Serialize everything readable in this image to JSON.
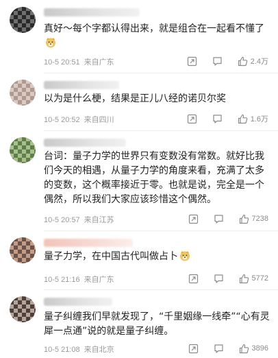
{
  "comments": [
    {
      "text": "真好～每个字都认得出来，就是组合在一起看不懂了",
      "time": "10-5 20:51",
      "location": "来自广东",
      "likes": "2.4万",
      "emoji": "doge-emoji"
    },
    {
      "text": "以为是什么梗，结果是正儿八经的诺贝尔奖",
      "time": "10-5 20:52",
      "location": "来自四川",
      "likes": "1.6万"
    },
    {
      "text": "台词：量子力学的世界只有变数没有常数。就好比我们今天的相遇，从量子力学的角度来看，充满了太多的变数，这个概率接近于零。也就是说，完全是一个偶然，所以我们大家应该珍惜这个偶然。",
      "time": "10-5 20:57",
      "location": "来自江苏",
      "likes": "7238"
    },
    {
      "text": "量子力学，在中国古代叫做占卜",
      "time": "10-5 21:16",
      "location": "来自广东",
      "likes": "5772",
      "emoji": "doge-emoji"
    },
    {
      "text": "量子纠缠我们早就发现了，“千里姻缘一线牵”“心有灵犀一点通”说的就是量子纠缠。",
      "time": "10-5 21:08",
      "location": "来自北京",
      "likes": "3896"
    }
  ],
  "icons": {
    "share": "share-icon",
    "reply": "comment-icon",
    "like": "thumbs-up-icon"
  },
  "colors": {
    "text": "#222222",
    "meta": "#9a9a9a",
    "icon": "#8a8a8a"
  }
}
